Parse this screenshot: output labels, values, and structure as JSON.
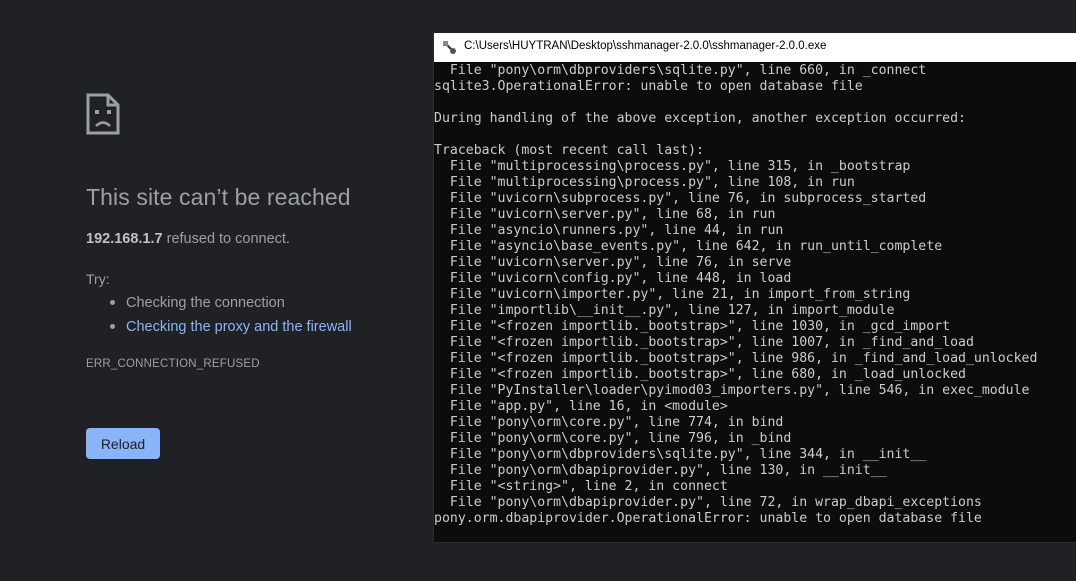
{
  "error_page": {
    "title": "This site can’t be reached",
    "host": "192.168.1.7",
    "description_suffix": " refused to connect.",
    "try_label": "Try:",
    "suggestions": [
      {
        "label": "Checking the connection",
        "is_link": false
      },
      {
        "label": "Checking the proxy and the firewall",
        "is_link": true
      }
    ],
    "error_code": "ERR_CONNECTION_REFUSED",
    "reload_label": "Reload",
    "icon": "sad-page-icon"
  },
  "console": {
    "title": "C:\\Users\\HUYTRAN\\Desktop\\sshmanager-2.0.0\\sshmanager-2.0.0.exe",
    "icon": "console-app-icon",
    "lines": [
      "  File \"pony\\orm\\dbproviders\\sqlite.py\", line 660, in _connect",
      "sqlite3.OperationalError: unable to open database file",
      "",
      "During handling of the above exception, another exception occurred:",
      "",
      "Traceback (most recent call last):",
      "  File \"multiprocessing\\process.py\", line 315, in _bootstrap",
      "  File \"multiprocessing\\process.py\", line 108, in run",
      "  File \"uvicorn\\subprocess.py\", line 76, in subprocess_started",
      "  File \"uvicorn\\server.py\", line 68, in run",
      "  File \"asyncio\\runners.py\", line 44, in run",
      "  File \"asyncio\\base_events.py\", line 642, in run_until_complete",
      "  File \"uvicorn\\server.py\", line 76, in serve",
      "  File \"uvicorn\\config.py\", line 448, in load",
      "  File \"uvicorn\\importer.py\", line 21, in import_from_string",
      "  File \"importlib\\__init__.py\", line 127, in import_module",
      "  File \"<frozen importlib._bootstrap>\", line 1030, in _gcd_import",
      "  File \"<frozen importlib._bootstrap>\", line 1007, in _find_and_load",
      "  File \"<frozen importlib._bootstrap>\", line 986, in _find_and_load_unlocked",
      "  File \"<frozen importlib._bootstrap>\", line 680, in _load_unlocked",
      "  File \"PyInstaller\\loader\\pyimod03_importers.py\", line 546, in exec_module",
      "  File \"app.py\", line 16, in <module>",
      "  File \"pony\\orm\\core.py\", line 774, in bind",
      "  File \"pony\\orm\\core.py\", line 796, in _bind",
      "  File \"pony\\orm\\dbproviders\\sqlite.py\", line 344, in __init__",
      "  File \"pony\\orm\\dbapiprovider.py\", line 130, in __init__",
      "  File \"<string>\", line 2, in connect",
      "  File \"pony\\orm\\dbapiprovider.py\", line 72, in wrap_dbapi_exceptions",
      "pony.orm.dbapiprovider.OperationalError: unable to open database file"
    ]
  },
  "colors": {
    "page_background": "#202124",
    "text_secondary": "#9aa0a6",
    "link": "#8ab4f8",
    "button": "#8ab4f8",
    "console_background": "#0c0c0c",
    "console_text": "#cccccc"
  }
}
